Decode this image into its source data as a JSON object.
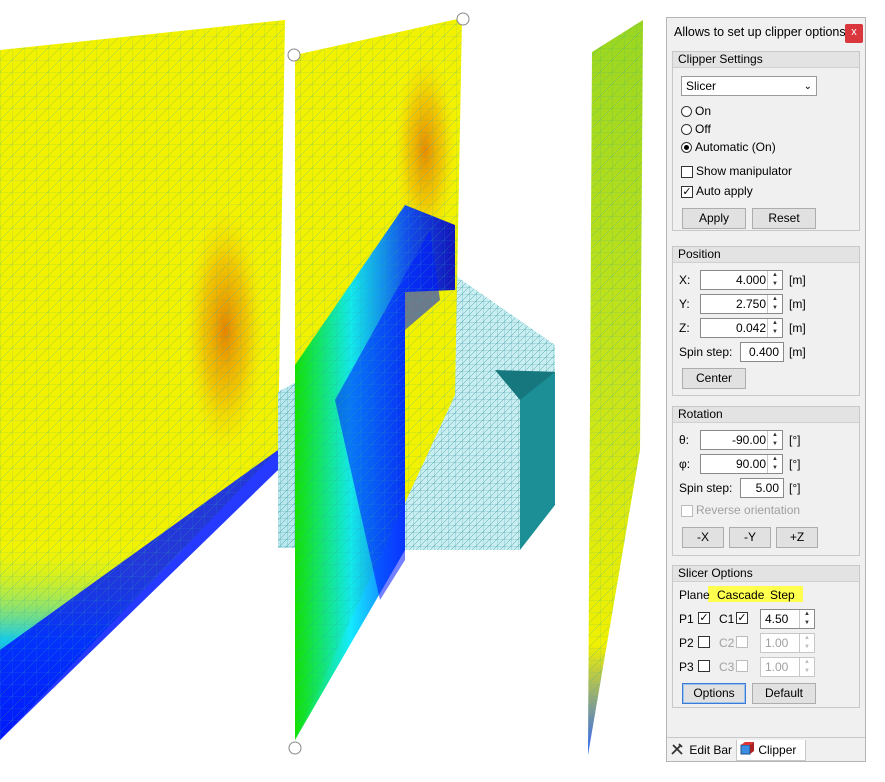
{
  "panel": {
    "title": "Allows to set up clipper options.",
    "close_label": "x",
    "clipper_settings": {
      "heading": "Clipper Settings",
      "mode_value": "Slicer",
      "radio_on": "On",
      "radio_off": "Off",
      "radio_auto": "Automatic (On)",
      "selected_radio": "Automatic (On)",
      "show_manipulator": "Show manipulator",
      "show_manipulator_checked": false,
      "auto_apply": "Auto apply",
      "auto_apply_checked": true,
      "apply_label": "Apply",
      "reset_label": "Reset"
    },
    "position": {
      "heading": "Position",
      "x_label": "X:",
      "x_value": "4.000",
      "y_label": "Y:",
      "y_value": "2.750",
      "z_label": "Z:",
      "z_value": "0.042",
      "unit": "[m]",
      "spin_step_label": "Spin step:",
      "spin_step_value": "0.400",
      "center_label": "Center"
    },
    "rotation": {
      "heading": "Rotation",
      "theta_label": "θ:",
      "theta_value": "-90.00",
      "phi_label": "φ:",
      "phi_value": "90.00",
      "unit": "[°]",
      "spin_step_label": "Spin step:",
      "spin_step_value": "5.00",
      "reverse_label": "Reverse orientation",
      "neg_x": "-X",
      "neg_y": "-Y",
      "pos_z": "+Z"
    },
    "slicer_options": {
      "heading": "Slicer Options",
      "col_plane": "Plane",
      "col_cascade": "Cascade",
      "col_step": "Step",
      "rows": [
        {
          "plane": "P1",
          "cascade": "C1",
          "step": "4.50",
          "plane_checked": true,
          "cascade_checked": true,
          "enabled": true
        },
        {
          "plane": "P2",
          "cascade": "C2",
          "step": "1.00",
          "plane_checked": false,
          "cascade_checked": false,
          "enabled": false
        },
        {
          "plane": "P3",
          "cascade": "C3",
          "step": "1.00",
          "plane_checked": false,
          "cascade_checked": false,
          "enabled": false
        }
      ],
      "options_label": "Options",
      "default_label": "Default"
    },
    "tabs": [
      {
        "label": "Edit Bar",
        "icon": "tools-icon",
        "active": false
      },
      {
        "label": "Clipper",
        "icon": "clipper-cube-icon",
        "active": true
      }
    ]
  },
  "colors": {
    "highlight": "#ffff4d",
    "close_bg": "#d9363e",
    "focus_border": "#3b7bd4"
  }
}
